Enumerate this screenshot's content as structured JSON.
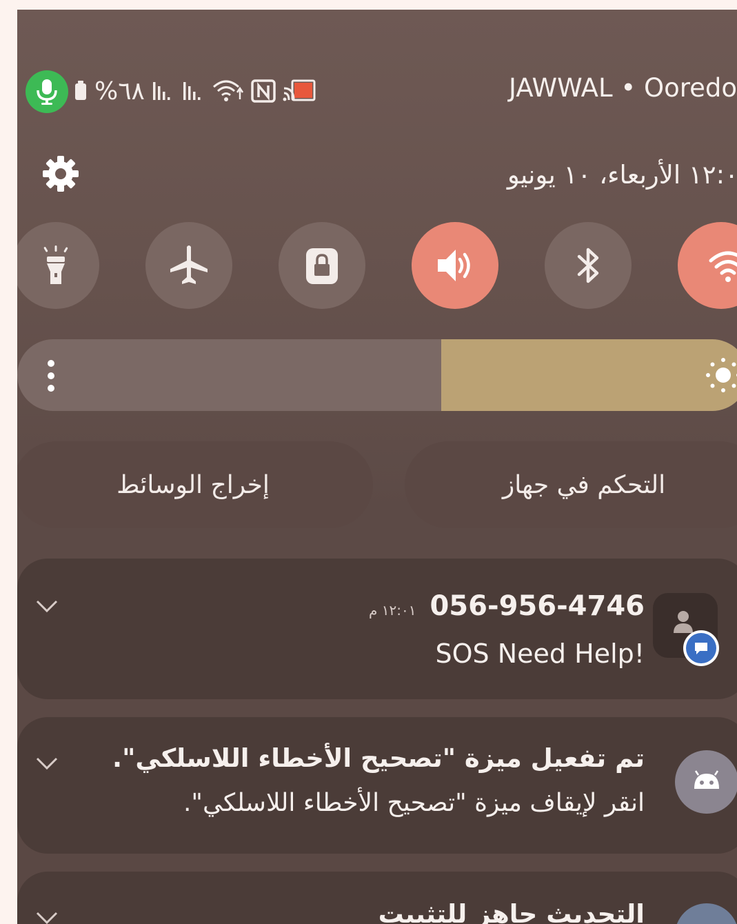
{
  "status_bar": {
    "battery_percent": "%٦٨",
    "carrier": "JAWWAL • Ooredo",
    "icons": [
      "microphone-icon",
      "battery-icon",
      "signal-icon",
      "signal-icon",
      "wifi-calling-icon",
      "nfc-icon",
      "cast-icon"
    ]
  },
  "header": {
    "datetime": "١٢:٠ الأربعاء، ١٠ يونيو"
  },
  "quick_settings": [
    {
      "name": "flashlight",
      "active": false
    },
    {
      "name": "airplane-mode",
      "active": false
    },
    {
      "name": "screen-lock",
      "active": false
    },
    {
      "name": "sound",
      "active": true
    },
    {
      "name": "bluetooth",
      "active": false
    },
    {
      "name": "wifi",
      "active": true
    }
  ],
  "brightness": {
    "level": 0.42
  },
  "media": {
    "output_label": "إخراج الوسائط",
    "device_control_label": "التحكم في جهاز"
  },
  "notifications": [
    {
      "title": "056-956-4746",
      "time": "١٢:٠١ م",
      "body": "SOS Need Help!"
    },
    {
      "title": "تم تفعيل ميزة \"تصحيح الأخطاء اللاسلكي\".",
      "body": "انقر لإيقاف ميزة \"تصحيح الأخطاء اللاسلكي\"."
    },
    {
      "title": "التحديث جاهز للتثبيت"
    }
  ],
  "colors": {
    "panel": "#66524d",
    "toggle_on": "#e98876",
    "toggle_off": "#7a6762",
    "brightness_fill": "#bba274",
    "mic_green": "#3dba55",
    "card": "#4b3c38"
  }
}
